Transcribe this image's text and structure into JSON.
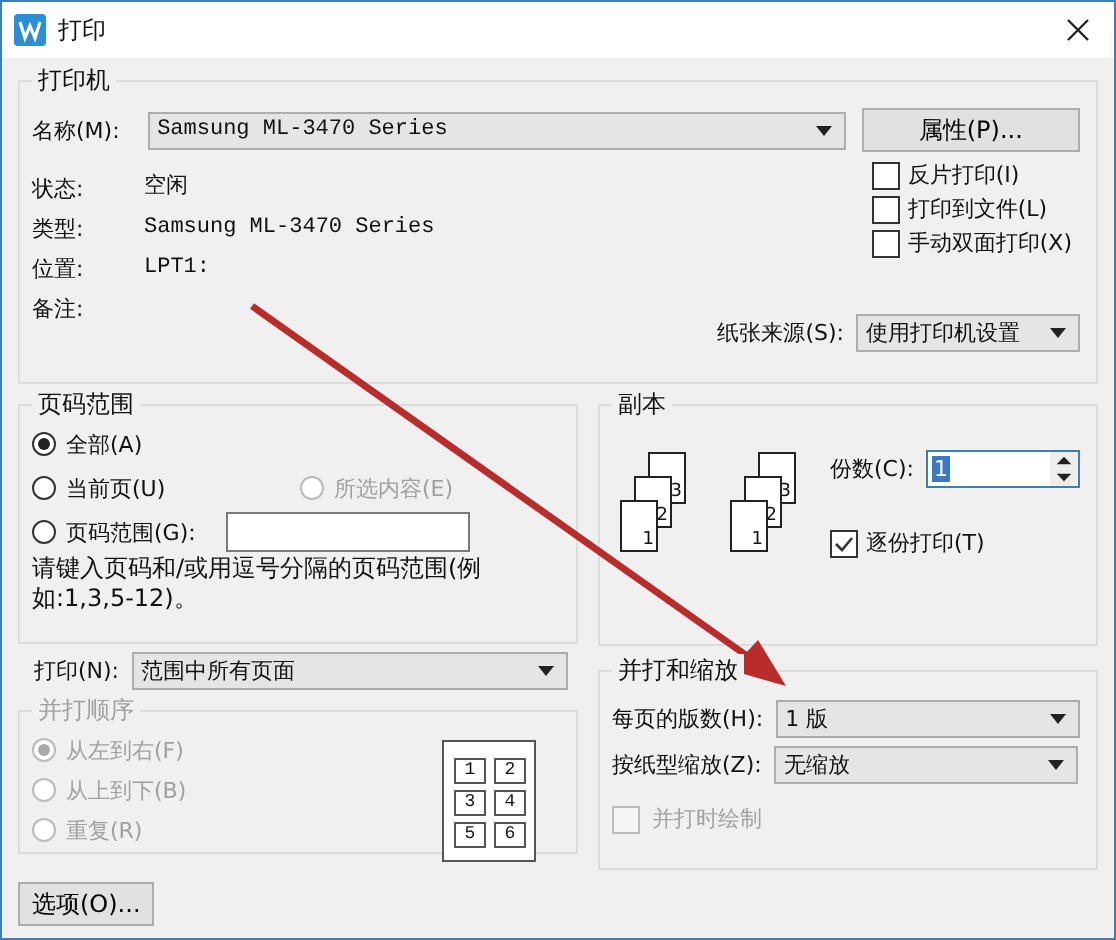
{
  "window": {
    "title": "打印"
  },
  "printer": {
    "title": "打印机",
    "name_label": "名称(M):",
    "name_value": "Samsung ML-3470 Series",
    "properties_button": "属性(P)...",
    "info": [
      {
        "label": "状态:",
        "value": "空闲"
      },
      {
        "label": "类型:",
        "value": "Samsung ML-3470 Series"
      },
      {
        "label": "位置:",
        "value": "LPT1:"
      },
      {
        "label": "备注:"
      }
    ],
    "options": [
      {
        "label": "反片打印(I)",
        "checked": false
      },
      {
        "label": "打印到文件(L)",
        "checked": false
      },
      {
        "label": "手动双面打印(X)",
        "checked": false
      }
    ],
    "paper_source_label": "纸张来源(S):",
    "paper_source_value": "使用打印机设置"
  },
  "page_range": {
    "title": "页码范围",
    "options": [
      {
        "label": "全部(A)",
        "selected": true,
        "disabled": false
      },
      {
        "label": "当前页(U)",
        "selected": false,
        "disabled": false
      },
      {
        "label": "所选内容(E)",
        "selected": false,
        "disabled": true
      },
      {
        "label": "页码范围(G):",
        "selected": false,
        "disabled": false
      }
    ],
    "hint": "请键入页码和/或用逗号分隔的页码范围(例如:1,3,5-12)。"
  },
  "copies": {
    "title": "副本",
    "page_stacks": [
      [
        "3",
        "2",
        "1"
      ],
      [
        "3",
        "2",
        "1"
      ]
    ],
    "count_label": "份数(C):",
    "count_value": "1",
    "collate": {
      "label": "逐份打印(T)",
      "checked": true
    }
  },
  "print": {
    "label": "打印(N):",
    "value": "范围中所有页面"
  },
  "order": {
    "title": "并打顺序",
    "disabled": true,
    "options": [
      {
        "label": "从左到右(F)",
        "selected": true
      },
      {
        "label": "从上到下(B)",
        "selected": false
      },
      {
        "label": "重复(R)",
        "selected": false
      }
    ],
    "preview": [
      "1",
      "2",
      "3",
      "4",
      "5",
      "6"
    ]
  },
  "scaling": {
    "title": "并打和缩放",
    "rows": [
      {
        "label": "每页的版数(H):",
        "value": "1 版"
      },
      {
        "label": "按纸型缩放(Z):",
        "value": "无缩放"
      }
    ],
    "draw_border": {
      "label": "并打时绘制",
      "checked": false,
      "disabled": true
    }
  },
  "options_button": "选项(O)..."
}
